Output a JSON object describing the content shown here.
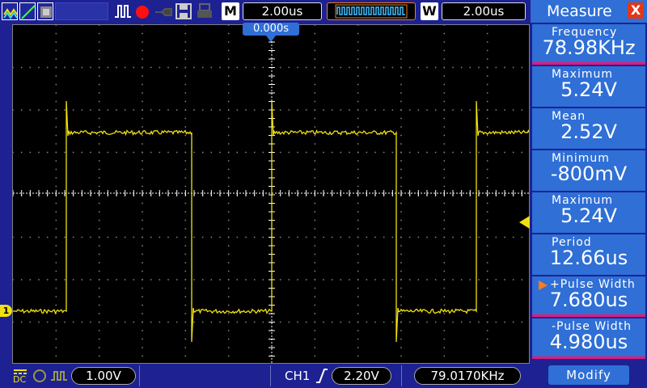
{
  "topbar": {
    "timebase_label": "M",
    "timebase_value": "2.00us",
    "window_label": "W",
    "window_value": "2.00us",
    "icons": [
      "wave-mode-icon",
      "line-mode-icon",
      "persist-mode-icon",
      "run-stop-icon",
      "record-icon",
      "probe-icon",
      "save-icon",
      "print-icon"
    ]
  },
  "screen": {
    "trigger_position": "0.000s",
    "channel_marker": "1"
  },
  "panel": {
    "title": "Measure",
    "close_label": "X",
    "items": [
      {
        "label": "Frequency",
        "value": "78.98KHz",
        "selected": true
      },
      {
        "label": "Maximum",
        "value": "5.24V",
        "selected": false
      },
      {
        "label": "Mean",
        "value": "2.52V",
        "selected": false
      },
      {
        "label": "Minimum",
        "value": "-800mV",
        "selected": false
      },
      {
        "label": "Maximum",
        "value": "5.24V",
        "selected": false
      },
      {
        "label": "Period",
        "value": "12.66us",
        "selected": false
      },
      {
        "label": "+Pulse Width",
        "value": "7.680us",
        "selected": true
      },
      {
        "label": "-Pulse Width",
        "value": "4.980us",
        "selected": true
      }
    ],
    "modify_label": "Modify"
  },
  "bottombar": {
    "coupling": "DC",
    "volts_div": "1.00V",
    "trigger_channel": "CH1",
    "trigger_level": "2.20V",
    "counter": "79.0170KHz"
  },
  "colors": {
    "trace": "#f0e010",
    "panel_bg": "#1d2192",
    "item_bg": "#2f6fd6",
    "selected_line": "#e8187a"
  }
}
